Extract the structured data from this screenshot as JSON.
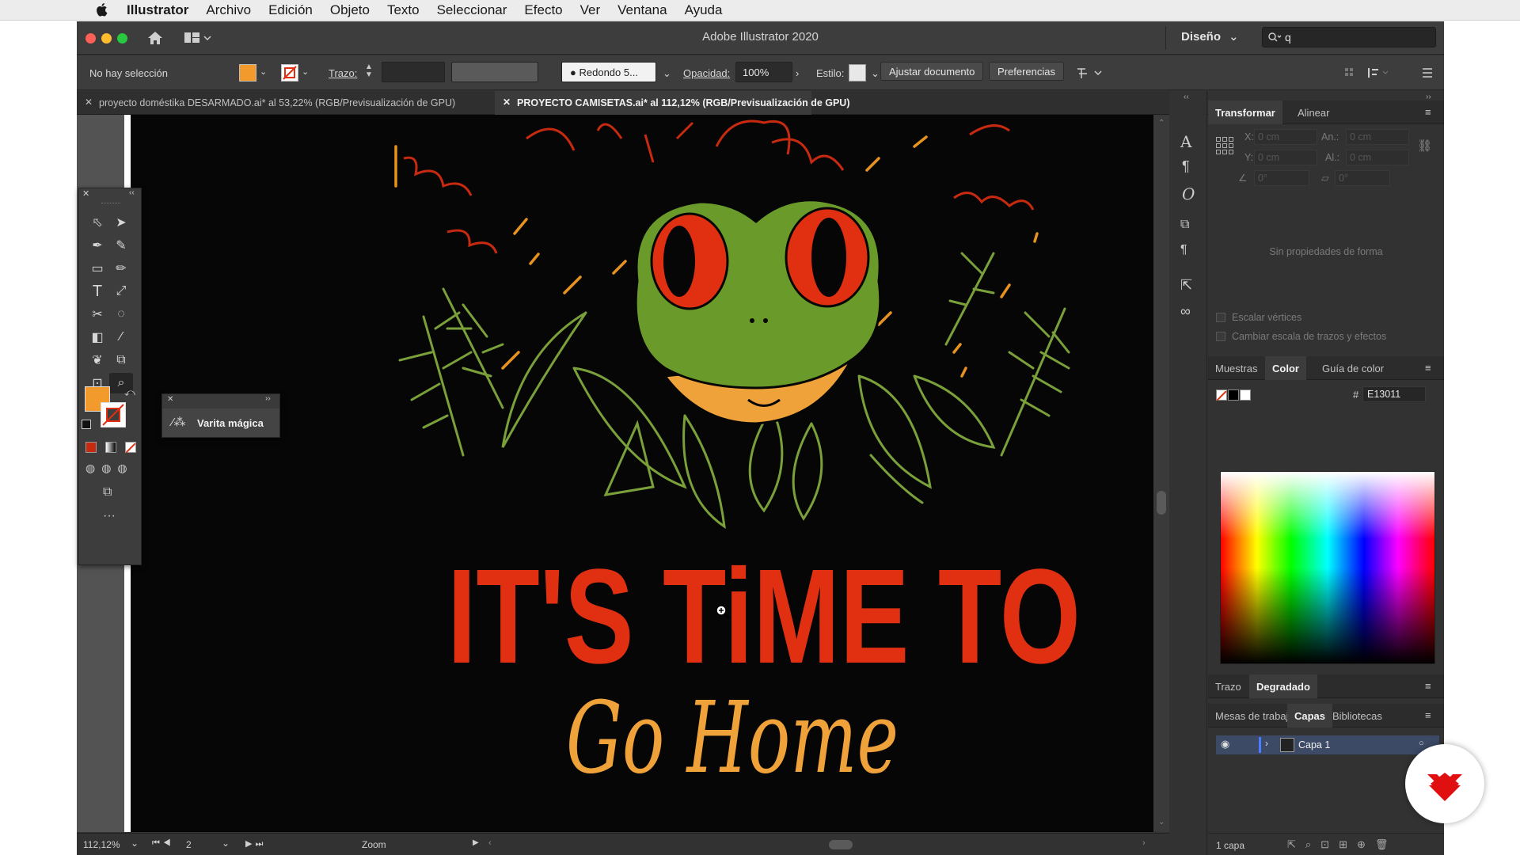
{
  "mac_menu": {
    "app": "Illustrator",
    "items": [
      "Archivo",
      "Edición",
      "Objeto",
      "Texto",
      "Seleccionar",
      "Efecto",
      "Ver",
      "Ventana",
      "Ayuda"
    ]
  },
  "window": {
    "title": "Adobe Illustrator 2020",
    "workspace": "Diseño",
    "search_value": "q"
  },
  "control": {
    "selection": "No hay selección",
    "fill_color": "#f39a2c",
    "stroke_label": "Trazo:",
    "brush": "Redondo 5...",
    "opacity_label": "Opacidad:",
    "opacity": "100%",
    "style_label": "Estilo:",
    "adjust_btn": "Ajustar documento",
    "prefs_btn": "Preferencias"
  },
  "tabs": [
    {
      "label": "proyecto doméstika DESARMADO.ai* al 53,22% (RGB/Previsualización de GPU)",
      "active": false
    },
    {
      "label": "PROYECTO CAMISETAS.ai* al 112,12% (RGB/Previsualización de GPU)",
      "active": true
    }
  ],
  "flyout": {
    "label": "Varita mágica"
  },
  "artwork": {
    "line1": "IT'S TiME TO",
    "line2": "Go Home"
  },
  "status": {
    "zoom": "112,12%",
    "artboard": "2",
    "tool": "Zoom"
  },
  "transform": {
    "tab1": "Transformar",
    "tab2": "Alinear",
    "x_label": "X:",
    "y_label": "Y:",
    "w_label": "An.:",
    "h_label": "Al.:",
    "x": "0 cm",
    "y": "0 cm",
    "w": "0 cm",
    "h": "0 cm",
    "angle": "0°",
    "shear": "0°",
    "empty": "Sin propiedades de forma",
    "check1": "Escalar vértices",
    "check2": "Cambiar escala de trazos y efectos"
  },
  "color_panel": {
    "tab1": "Muestras",
    "tab2": "Color",
    "tab3": "Guía de color",
    "hex_label": "#",
    "hex": "E13011"
  },
  "stroke_panel": {
    "tab1": "Trazo",
    "tab2": "Degradado"
  },
  "layers_panel": {
    "tab1": "Mesas de trabajo",
    "tab2": "Capas",
    "tab3": "Bibliotecas",
    "layer_name": "Capa 1",
    "count": "1 capa"
  },
  "colors": {
    "frog_green": "#6a9a2a",
    "eye_red": "#e13011",
    "mouth_orange": "#f0a23a",
    "leaf_green": "#7aa03a",
    "bg": "#060606",
    "brand": "#e01010"
  }
}
